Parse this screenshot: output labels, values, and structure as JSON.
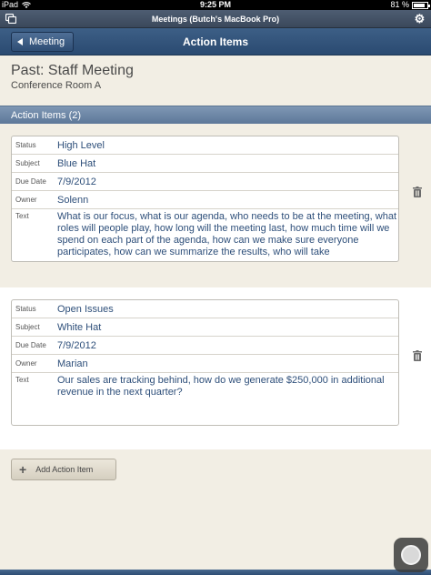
{
  "status_bar": {
    "device": "iPad",
    "time": "9:25 PM",
    "battery": "81 %"
  },
  "window": {
    "title": "Meetings (Butch's MacBook Pro)"
  },
  "nav": {
    "back_label": "Meeting",
    "title": "Action Items"
  },
  "meeting": {
    "title": "Past: Staff Meeting",
    "room": "Conference Room A"
  },
  "section": {
    "title": "Action Items (2)"
  },
  "field_labels": {
    "status": "Status",
    "subject": "Subject",
    "due_date": "Due Date",
    "owner": "Owner",
    "text": "Text"
  },
  "items": [
    {
      "status": "High Level",
      "subject": "Blue Hat",
      "due_date": "7/9/2012",
      "owner": "Solenn",
      "text": "What is our focus, what is our agenda, who needs to be at the meeting, what roles will people play, how long will the meeting last, how much time will we spend on each part of the agenda, how can we make sure everyone participates, how can we summarize the results, who will take"
    },
    {
      "status": "Open Issues",
      "subject": "White Hat",
      "due_date": "7/9/2012",
      "owner": "Marian",
      "text": "Our sales are tracking behind, how do we generate $250,000 in additional revenue in the next quarter?"
    }
  ],
  "add_button": {
    "label": "Add Action Item"
  },
  "icons": {
    "back": "back-arrow-icon",
    "trash": "trash-icon",
    "settings": "gear-icon",
    "add": "plus-icon"
  }
}
